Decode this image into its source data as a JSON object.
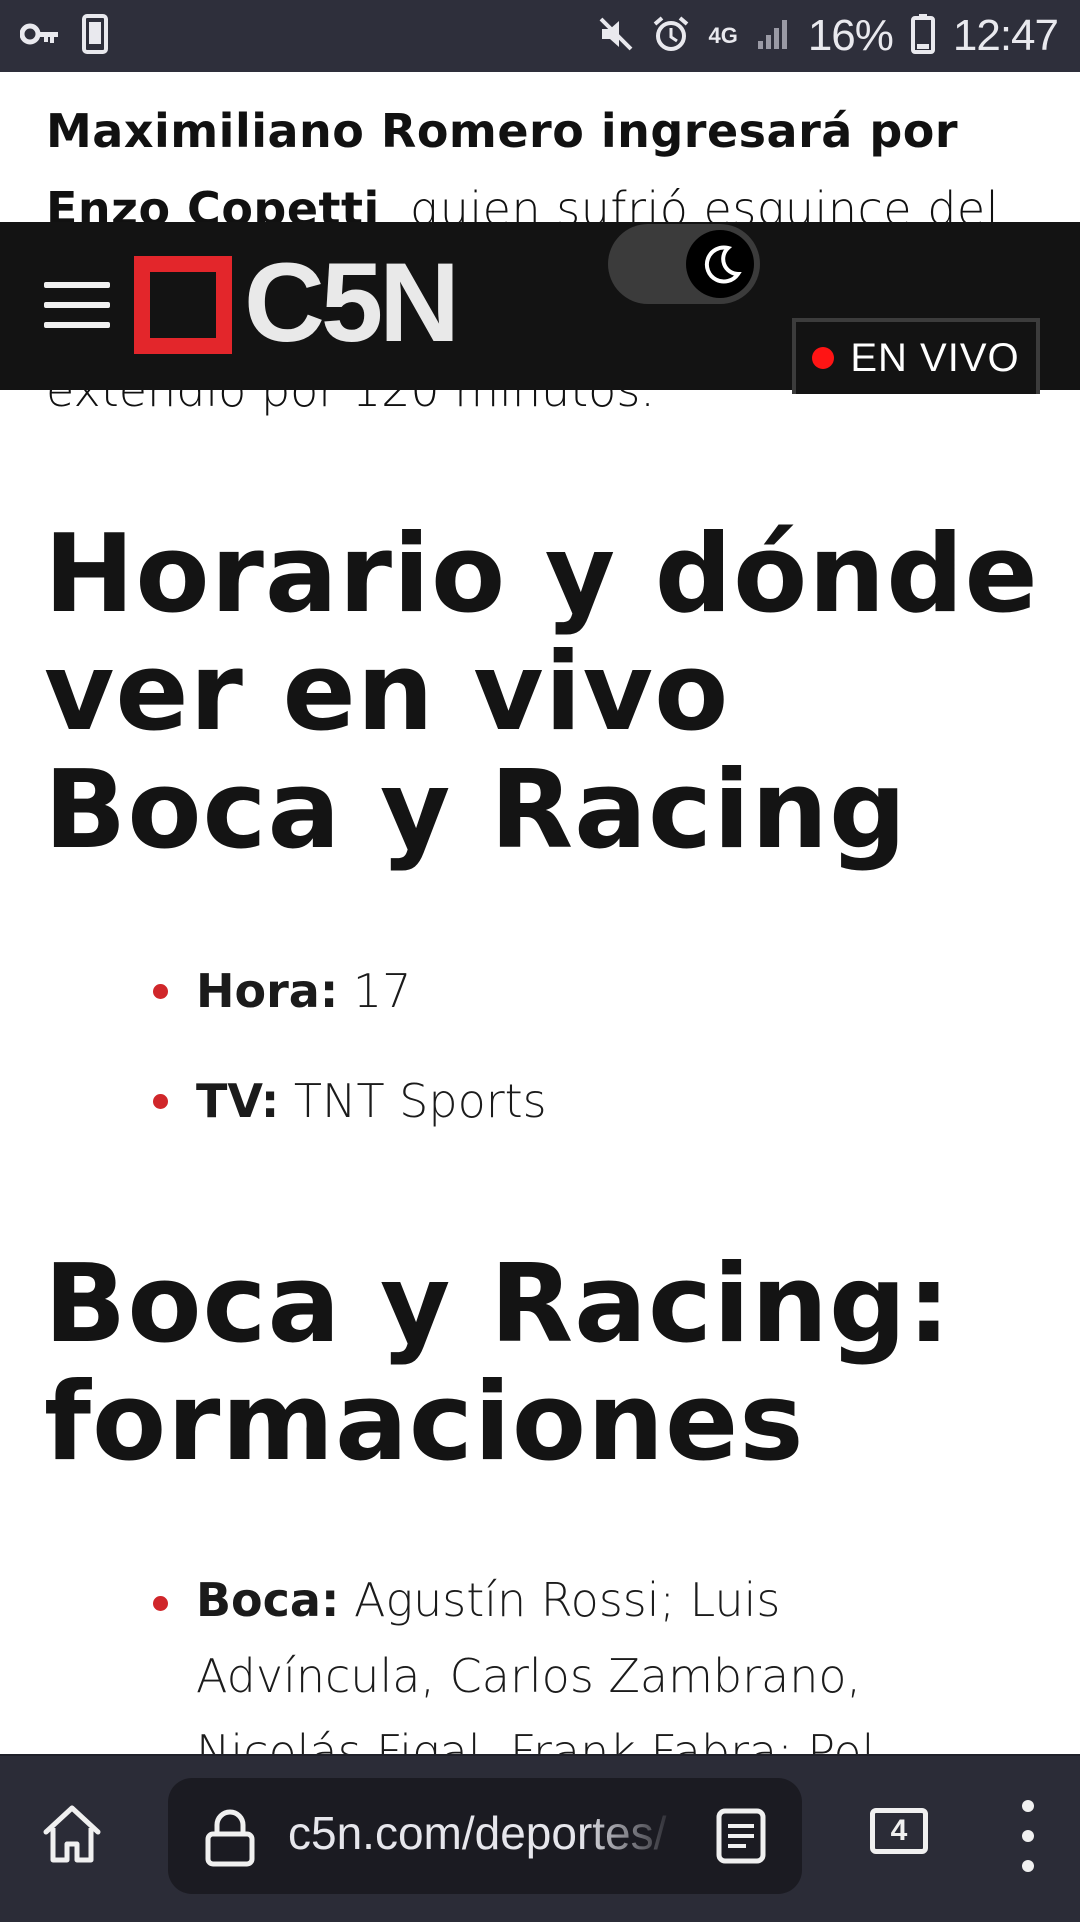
{
  "status_bar": {
    "battery": "16%",
    "time": "12:47",
    "network": "4G"
  },
  "article": {
    "prev_para_bold": "Maximiliano Romero ingresará por Enzo Copetti",
    "prev_para_rest": ", quien sufrió esguince del tobillo",
    "cut_para": "extendió por 120 minutos.",
    "heading_schedule": "Horario y dónde ver en vivo Boca y Racing",
    "schedule_items": [
      {
        "label": "Hora:",
        "value": " 17"
      },
      {
        "label": "TV:",
        "value": " TNT Sports"
      }
    ],
    "heading_lineups": "Boca y Racing: formaciones",
    "lineup_items": [
      {
        "label": "Boca:",
        "value": " Agustín Rossi; Luis Advíncula, Carlos Zambrano, Nicolás Figal, Frank Fabra; Pol"
      }
    ]
  },
  "header": {
    "logo_text": "C5N",
    "live_label": "EN VIVO"
  },
  "browser": {
    "url": "c5n.com/deportes/",
    "tab_count": "4"
  }
}
